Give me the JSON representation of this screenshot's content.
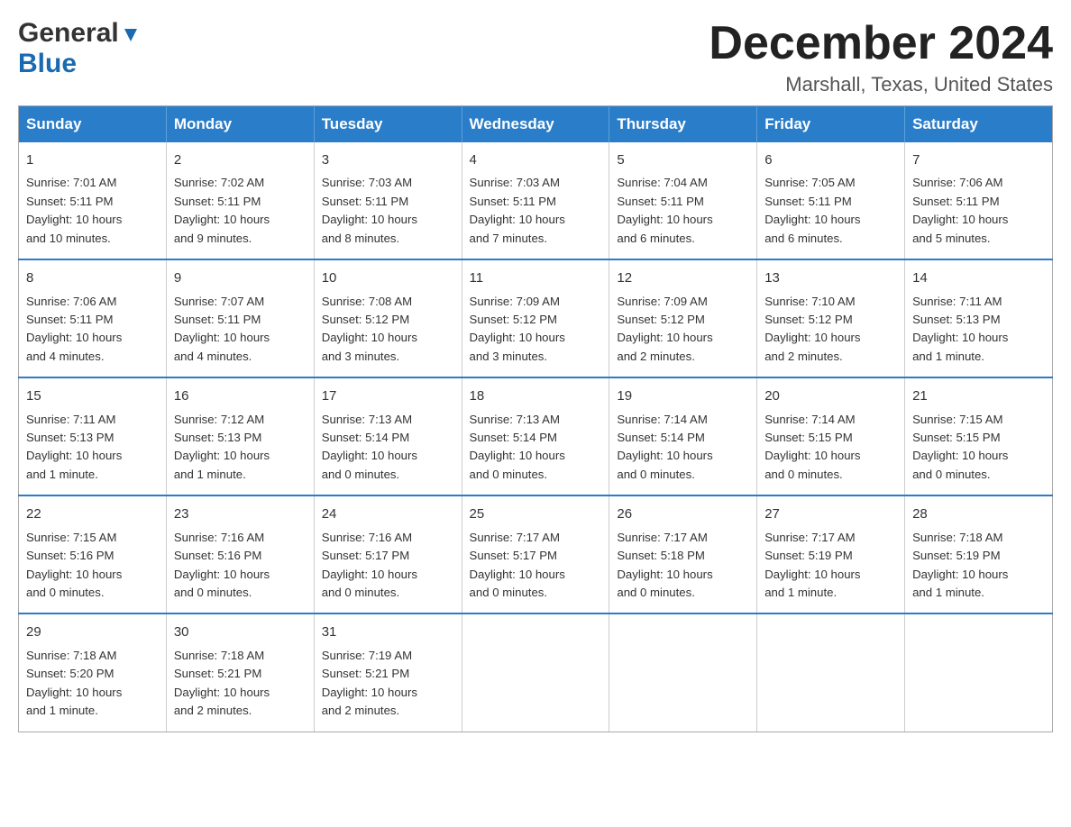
{
  "header": {
    "logo_general": "General",
    "logo_blue": "Blue",
    "main_title": "December 2024",
    "subtitle": "Marshall, Texas, United States"
  },
  "days_of_week": [
    "Sunday",
    "Monday",
    "Tuesday",
    "Wednesday",
    "Thursday",
    "Friday",
    "Saturday"
  ],
  "weeks": [
    [
      {
        "day": "1",
        "sunrise": "7:01 AM",
        "sunset": "5:11 PM",
        "daylight": "10 hours and 10 minutes."
      },
      {
        "day": "2",
        "sunrise": "7:02 AM",
        "sunset": "5:11 PM",
        "daylight": "10 hours and 9 minutes."
      },
      {
        "day": "3",
        "sunrise": "7:03 AM",
        "sunset": "5:11 PM",
        "daylight": "10 hours and 8 minutes."
      },
      {
        "day": "4",
        "sunrise": "7:03 AM",
        "sunset": "5:11 PM",
        "daylight": "10 hours and 7 minutes."
      },
      {
        "day": "5",
        "sunrise": "7:04 AM",
        "sunset": "5:11 PM",
        "daylight": "10 hours and 6 minutes."
      },
      {
        "day": "6",
        "sunrise": "7:05 AM",
        "sunset": "5:11 PM",
        "daylight": "10 hours and 6 minutes."
      },
      {
        "day": "7",
        "sunrise": "7:06 AM",
        "sunset": "5:11 PM",
        "daylight": "10 hours and 5 minutes."
      }
    ],
    [
      {
        "day": "8",
        "sunrise": "7:06 AM",
        "sunset": "5:11 PM",
        "daylight": "10 hours and 4 minutes."
      },
      {
        "day": "9",
        "sunrise": "7:07 AM",
        "sunset": "5:11 PM",
        "daylight": "10 hours and 4 minutes."
      },
      {
        "day": "10",
        "sunrise": "7:08 AM",
        "sunset": "5:12 PM",
        "daylight": "10 hours and 3 minutes."
      },
      {
        "day": "11",
        "sunrise": "7:09 AM",
        "sunset": "5:12 PM",
        "daylight": "10 hours and 3 minutes."
      },
      {
        "day": "12",
        "sunrise": "7:09 AM",
        "sunset": "5:12 PM",
        "daylight": "10 hours and 2 minutes."
      },
      {
        "day": "13",
        "sunrise": "7:10 AM",
        "sunset": "5:12 PM",
        "daylight": "10 hours and 2 minutes."
      },
      {
        "day": "14",
        "sunrise": "7:11 AM",
        "sunset": "5:13 PM",
        "daylight": "10 hours and 1 minute."
      }
    ],
    [
      {
        "day": "15",
        "sunrise": "7:11 AM",
        "sunset": "5:13 PM",
        "daylight": "10 hours and 1 minute."
      },
      {
        "day": "16",
        "sunrise": "7:12 AM",
        "sunset": "5:13 PM",
        "daylight": "10 hours and 1 minute."
      },
      {
        "day": "17",
        "sunrise": "7:13 AM",
        "sunset": "5:14 PM",
        "daylight": "10 hours and 0 minutes."
      },
      {
        "day": "18",
        "sunrise": "7:13 AM",
        "sunset": "5:14 PM",
        "daylight": "10 hours and 0 minutes."
      },
      {
        "day": "19",
        "sunrise": "7:14 AM",
        "sunset": "5:14 PM",
        "daylight": "10 hours and 0 minutes."
      },
      {
        "day": "20",
        "sunrise": "7:14 AM",
        "sunset": "5:15 PM",
        "daylight": "10 hours and 0 minutes."
      },
      {
        "day": "21",
        "sunrise": "7:15 AM",
        "sunset": "5:15 PM",
        "daylight": "10 hours and 0 minutes."
      }
    ],
    [
      {
        "day": "22",
        "sunrise": "7:15 AM",
        "sunset": "5:16 PM",
        "daylight": "10 hours and 0 minutes."
      },
      {
        "day": "23",
        "sunrise": "7:16 AM",
        "sunset": "5:16 PM",
        "daylight": "10 hours and 0 minutes."
      },
      {
        "day": "24",
        "sunrise": "7:16 AM",
        "sunset": "5:17 PM",
        "daylight": "10 hours and 0 minutes."
      },
      {
        "day": "25",
        "sunrise": "7:17 AM",
        "sunset": "5:17 PM",
        "daylight": "10 hours and 0 minutes."
      },
      {
        "day": "26",
        "sunrise": "7:17 AM",
        "sunset": "5:18 PM",
        "daylight": "10 hours and 0 minutes."
      },
      {
        "day": "27",
        "sunrise": "7:17 AM",
        "sunset": "5:19 PM",
        "daylight": "10 hours and 1 minute."
      },
      {
        "day": "28",
        "sunrise": "7:18 AM",
        "sunset": "5:19 PM",
        "daylight": "10 hours and 1 minute."
      }
    ],
    [
      {
        "day": "29",
        "sunrise": "7:18 AM",
        "sunset": "5:20 PM",
        "daylight": "10 hours and 1 minute."
      },
      {
        "day": "30",
        "sunrise": "7:18 AM",
        "sunset": "5:21 PM",
        "daylight": "10 hours and 2 minutes."
      },
      {
        "day": "31",
        "sunrise": "7:19 AM",
        "sunset": "5:21 PM",
        "daylight": "10 hours and 2 minutes."
      },
      null,
      null,
      null,
      null
    ]
  ],
  "labels": {
    "sunrise": "Sunrise:",
    "sunset": "Sunset:",
    "daylight": "Daylight:"
  }
}
